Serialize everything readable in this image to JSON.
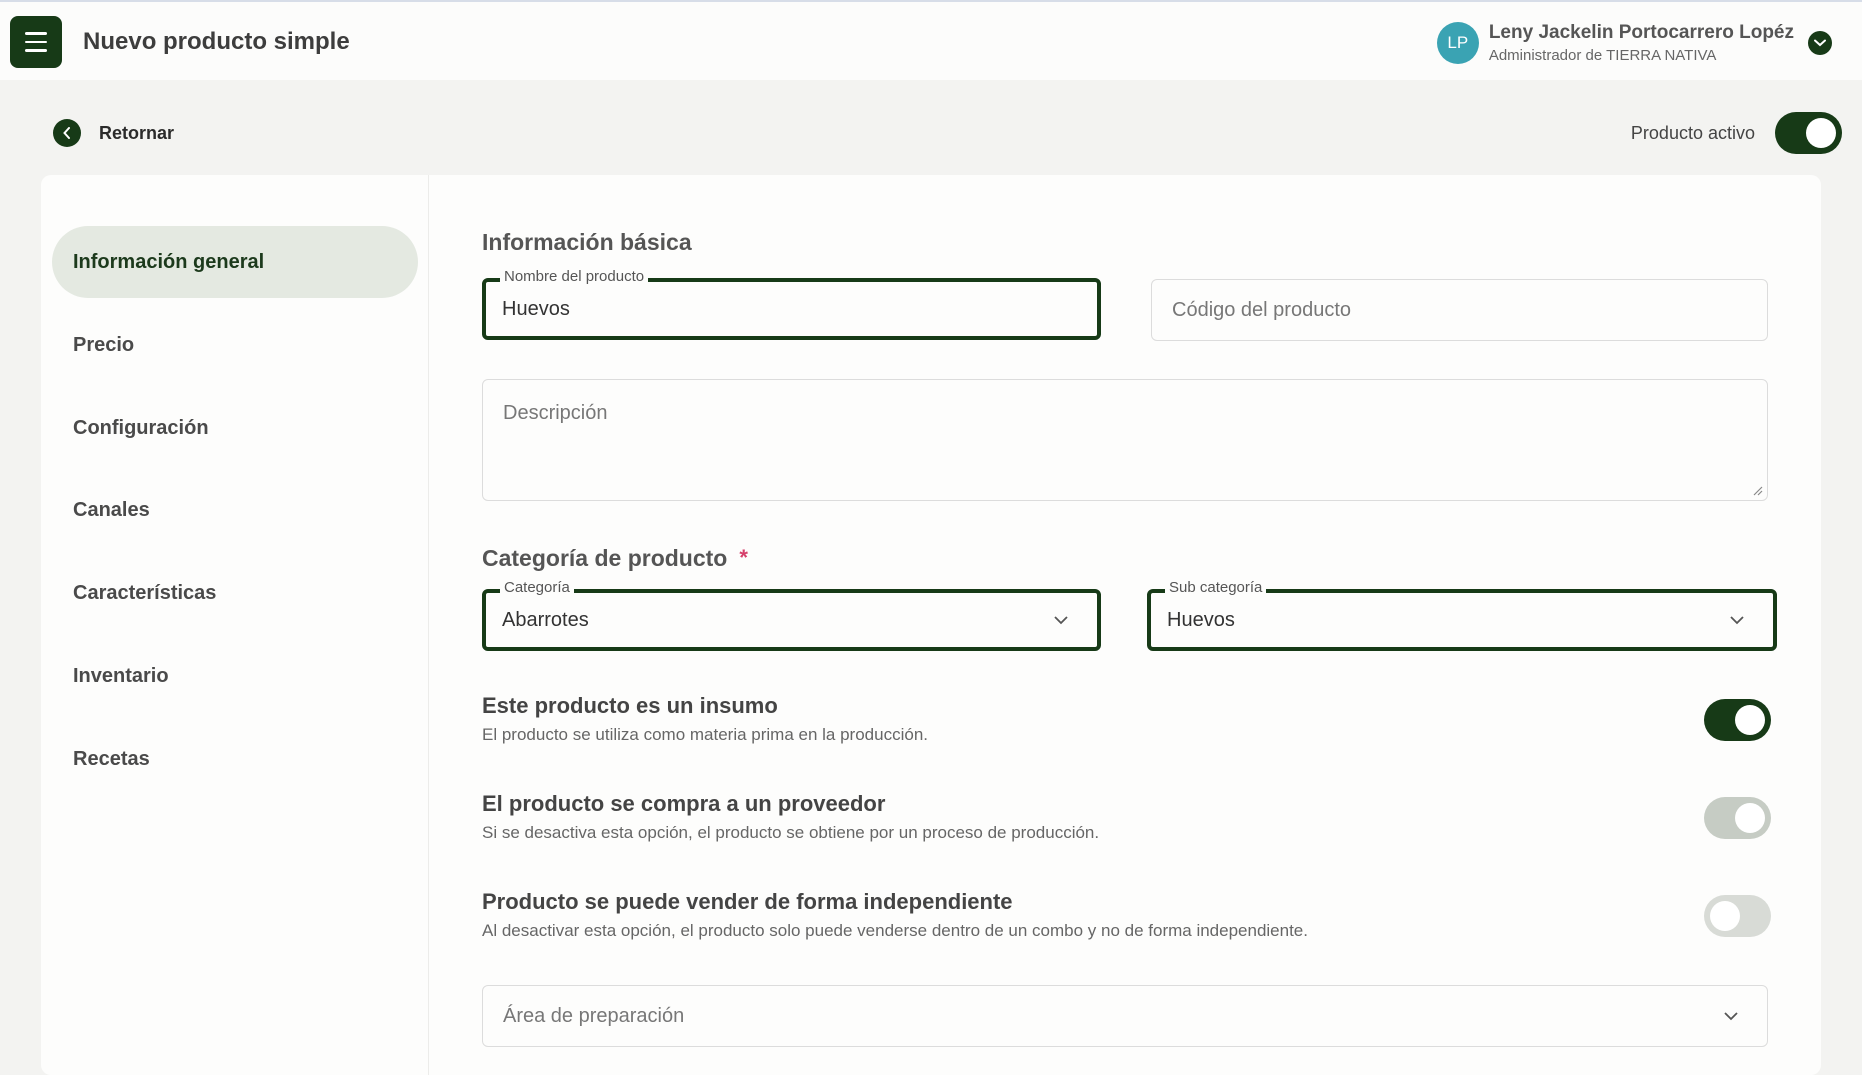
{
  "header": {
    "title": "Nuevo producto simple",
    "user": {
      "initials": "LP",
      "name": "Leny Jackelin Portocarrero Lopéz",
      "role": "Administrador de TIERRA NATIVA"
    }
  },
  "back_label": "Retornar",
  "active": {
    "label": "Producto activo",
    "value": true
  },
  "nav": [
    {
      "label": "Información general",
      "active": true
    },
    {
      "label": "Precio",
      "active": false
    },
    {
      "label": "Configuración",
      "active": false
    },
    {
      "label": "Canales",
      "active": false
    },
    {
      "label": "Características",
      "active": false
    },
    {
      "label": "Inventario",
      "active": false
    },
    {
      "label": "Recetas",
      "active": false
    }
  ],
  "basic": {
    "title": "Información básica",
    "name_label": "Nombre del producto",
    "name_value": "Huevos",
    "code_placeholder": "Código del producto",
    "description_placeholder": "Descripción"
  },
  "category": {
    "title": "Categoría de producto",
    "required_mark": "*",
    "category_label": "Categoría",
    "category_value": "Abarrotes",
    "subcategory_label": "Sub categoría",
    "subcategory_value": "Huevos"
  },
  "options": [
    {
      "title": "Este producto es un insumo",
      "description": "El producto se utiliza como materia prima en la producción.",
      "state": "on"
    },
    {
      "title": "El producto se compra a un proveedor",
      "description": "Si se desactiva esta opción, el producto se obtiene por un proceso de producción.",
      "state": "on-disabled"
    },
    {
      "title": "Producto se puede vender de forma independiente",
      "description": "Al desactivar esta opción, el producto solo puede venderse dentro de un combo y no de forma independiente.",
      "state": "off"
    }
  ],
  "prep_area_placeholder": "Área de preparación",
  "colors": {
    "primary": "#173a17",
    "avatar": "#3aa3b3",
    "nav_active_bg": "#e4e9e1",
    "required": "#d6406b"
  }
}
